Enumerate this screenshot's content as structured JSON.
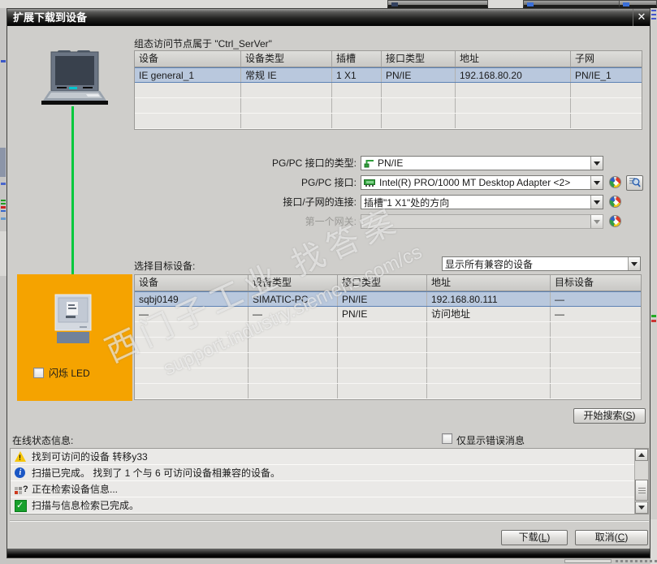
{
  "dialog": {
    "title": "扩展下载到设备",
    "close_glyph": "✕",
    "caption": "组态访问节点属于 \"Ctrl_SerVer\"",
    "access_table": {
      "headers": [
        "设备",
        "设备类型",
        "插槽",
        "接口类型",
        "地址",
        "子网"
      ],
      "rows": [
        [
          "IE general_1",
          "常规 IE",
          "1 X1",
          "PN/IE",
          "192.168.80.20",
          "PN/IE_1"
        ]
      ]
    },
    "fields": {
      "pgpc_type_label": "PG/PC 接口的类型:",
      "pgpc_type_value": "PN/IE",
      "pgpc_if_label": "PG/PC 接口:",
      "pgpc_if_value": "Intel(R) PRO/1000 MT Desktop Adapter <2>",
      "conn_label": "接口/子网的连接:",
      "conn_value": "插槽\"1 X1\"处的方向",
      "gateway_label": "第一个网关:",
      "gateway_value": ""
    },
    "target": {
      "select_label": "选择目标设备:",
      "filter_value": "显示所有兼容的设备",
      "table": {
        "headers": [
          "设备",
          "设备类型",
          "接口类型",
          "地址",
          "目标设备"
        ],
        "rows": [
          [
            "sqbj0149",
            "SIMATIC-PC",
            "PN/IE",
            "192.168.80.111",
            "—"
          ],
          [
            "—",
            "—",
            "PN/IE",
            "访问地址",
            "—"
          ]
        ]
      }
    },
    "flash_led_label": "闪烁 LED",
    "start_search_label": "开始搜索(S)",
    "online_status_label": "在线状态信息:",
    "only_errors_label": "仅显示错误消息",
    "messages": [
      {
        "icon": "warning",
        "text": "找到可访问的设备 转移y33"
      },
      {
        "icon": "info",
        "text": "扫描已完成。 找到了 1 个与 6 可访问设备相兼容的设备。"
      },
      {
        "icon": "query",
        "text": "正在检索设备信息..."
      },
      {
        "icon": "success",
        "text": "扫描与信息检索已完成。"
      }
    ],
    "download_label": "下载(L)",
    "cancel_label": "取消(C)"
  },
  "watermark": {
    "line1": "西门子工业  找答案",
    "line2": "support.industry.siemens.com/cs"
  },
  "colors": {
    "orange_panel": "#F5A300",
    "selection_row": "#B9C8DD",
    "connection_green": "#00C83C",
    "titlebar": "#000000"
  }
}
